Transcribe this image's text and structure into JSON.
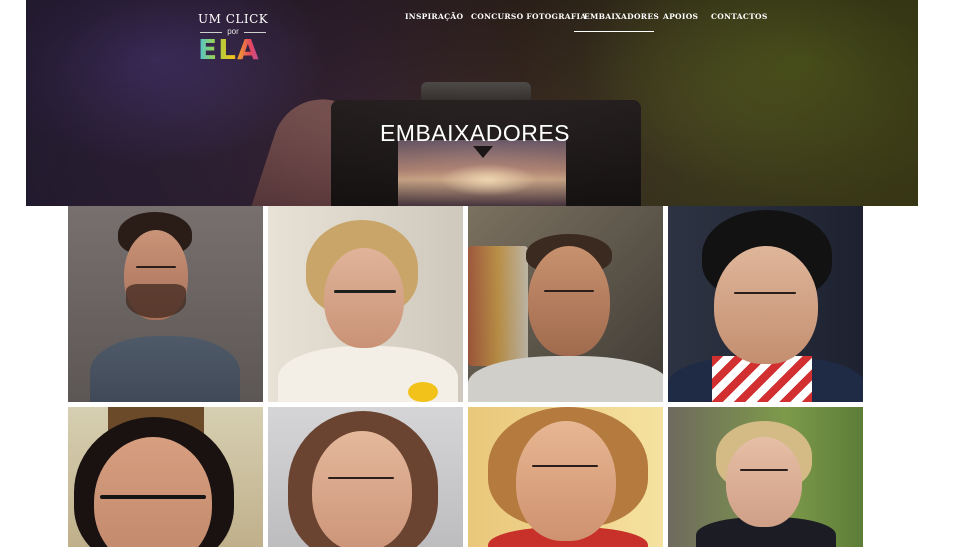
{
  "logo": {
    "line1": "UM CLICK",
    "por": "por",
    "ela": "ELA"
  },
  "nav": {
    "items": [
      {
        "label": "INSPIRAÇÃO"
      },
      {
        "label": "CONCURSO FOTOGRAFIA"
      },
      {
        "label": "EMBAIXADORES",
        "active": true
      },
      {
        "label": "APOIOS"
      },
      {
        "label": "CONTACTOS"
      }
    ]
  },
  "hero": {
    "title": "EMBAIXADORES"
  },
  "colors": {
    "nav_text": "#ffffff",
    "hero_left": "#3b2d4f",
    "hero_right": "#5b5a22",
    "page_bg": "#ffffff"
  }
}
